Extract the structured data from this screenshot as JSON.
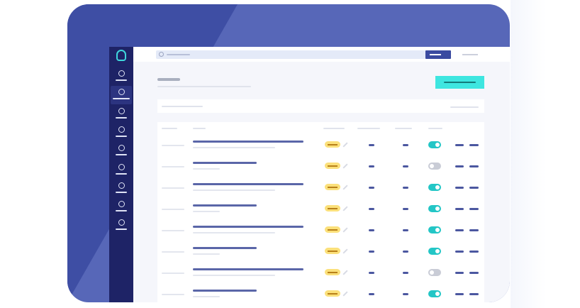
{
  "colors": {
    "frame": "#3e4ea4",
    "frame_light": "#5767b8",
    "sidebar": "#1e2366",
    "accent": "#3ee6e0",
    "toggle_on": "#23c6c6",
    "badge": "#fbe07a",
    "row_title": "#5a66a8"
  },
  "sidebar": {
    "logo_icon": "logo-icon",
    "items": [
      {
        "icon": "home-icon",
        "active": false
      },
      {
        "icon": "target-icon",
        "active": true
      },
      {
        "icon": "user-circle-icon",
        "active": false
      },
      {
        "icon": "users-icon",
        "active": false
      },
      {
        "icon": "globe-icon",
        "active": false
      },
      {
        "icon": "filter-icon",
        "active": false
      },
      {
        "icon": "warning-icon",
        "active": false
      },
      {
        "icon": "gear-icon",
        "active": false
      },
      {
        "icon": "credit-card-icon",
        "active": false
      }
    ]
  },
  "table": {
    "rows": [
      {
        "title": "long",
        "enabled": true
      },
      {
        "title": "short",
        "enabled": false
      },
      {
        "title": "long",
        "enabled": true
      },
      {
        "title": "short",
        "enabled": true
      },
      {
        "title": "long",
        "enabled": true
      },
      {
        "title": "short",
        "enabled": true
      },
      {
        "title": "long",
        "enabled": false
      },
      {
        "title": "short",
        "enabled": true
      }
    ]
  }
}
